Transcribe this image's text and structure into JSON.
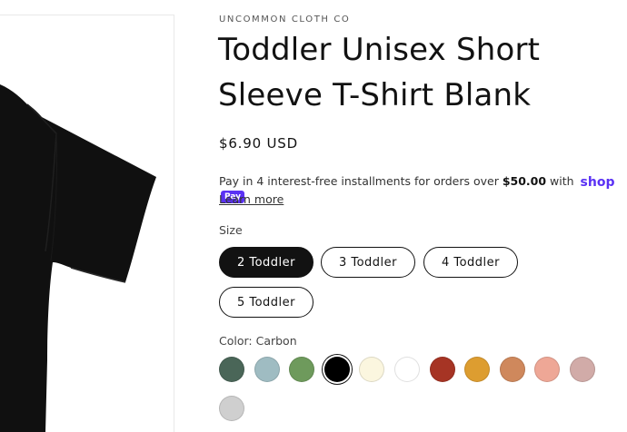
{
  "product": {
    "vendor": "UNCOMMON CLOTH CO",
    "title": "Toddler Unisex Short Sleeve T-Shirt Blank",
    "price": "$6.90 USD",
    "image_alt": "black t-shirt product image"
  },
  "installments": {
    "text_before": "Pay in 4 interest-free installments for orders over ",
    "threshold": "$50.00",
    "text_after": " with",
    "shop_logo": "shop",
    "pay_badge": "Pay",
    "learn_more": "Learn more"
  },
  "size": {
    "label": "Size",
    "options": [
      "2 Toddler",
      "3 Toddler",
      "4 Toddler",
      "5 Toddler"
    ],
    "selected": "2 Toddler"
  },
  "color": {
    "label": "Color: Carbon",
    "selected_index": 3,
    "swatches": [
      {
        "name": "Dark Green Gray",
        "hex": "#4a6658"
      },
      {
        "name": "Light Blue Gray",
        "hex": "#9fbcc2"
      },
      {
        "name": "Sage Green",
        "hex": "#6e9a5c"
      },
      {
        "name": "Carbon",
        "hex": "#000000"
      },
      {
        "name": "Cream",
        "hex": "#fbf6df"
      },
      {
        "name": "White",
        "hex": "#ffffff"
      },
      {
        "name": "Rust Red",
        "hex": "#a63424"
      },
      {
        "name": "Mustard",
        "hex": "#dd9d30"
      },
      {
        "name": "Terracotta",
        "hex": "#cf885c"
      },
      {
        "name": "Peach",
        "hex": "#eea796"
      },
      {
        "name": "Dusty Rose",
        "hex": "#d1aba8"
      },
      {
        "name": "Light Gray",
        "hex": "#cfcfcf"
      }
    ]
  }
}
